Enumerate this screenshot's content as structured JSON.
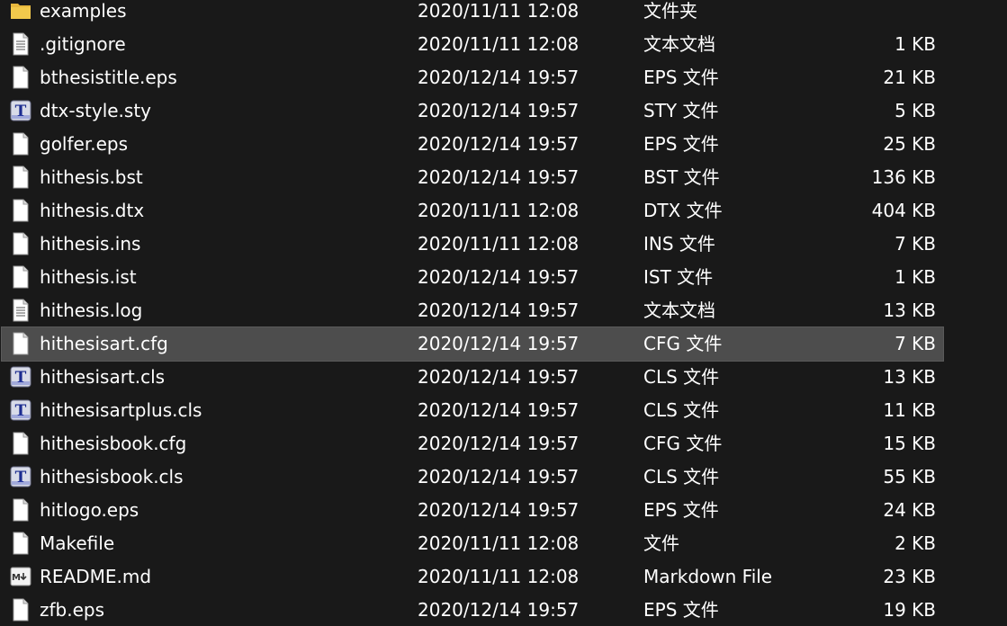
{
  "files": [
    {
      "name": "examples",
      "date": "2020/11/11 12:08",
      "type": "文件夹",
      "size": "",
      "icon": "folder-icon"
    },
    {
      "name": ".gitignore",
      "date": "2020/11/11 12:08",
      "type": "文本文档",
      "size": "1 KB",
      "icon": "text-file-icon"
    },
    {
      "name": "bthesistitle.eps",
      "date": "2020/12/14 19:57",
      "type": "EPS 文件",
      "size": "21 KB",
      "icon": "file-icon"
    },
    {
      "name": "dtx-style.sty",
      "date": "2020/12/14 19:57",
      "type": "STY 文件",
      "size": "5 KB",
      "icon": "tex-file-icon"
    },
    {
      "name": "golfer.eps",
      "date": "2020/12/14 19:57",
      "type": "EPS 文件",
      "size": "25 KB",
      "icon": "file-icon"
    },
    {
      "name": "hithesis.bst",
      "date": "2020/12/14 19:57",
      "type": "BST 文件",
      "size": "136 KB",
      "icon": "file-icon"
    },
    {
      "name": "hithesis.dtx",
      "date": "2020/11/11 12:08",
      "type": "DTX 文件",
      "size": "404 KB",
      "icon": "file-icon"
    },
    {
      "name": "hithesis.ins",
      "date": "2020/11/11 12:08",
      "type": "INS 文件",
      "size": "7 KB",
      "icon": "file-icon"
    },
    {
      "name": "hithesis.ist",
      "date": "2020/12/14 19:57",
      "type": "IST 文件",
      "size": "1 KB",
      "icon": "file-icon"
    },
    {
      "name": "hithesis.log",
      "date": "2020/12/14 19:57",
      "type": "文本文档",
      "size": "13 KB",
      "icon": "text-file-icon"
    },
    {
      "name": "hithesisart.cfg",
      "date": "2020/12/14 19:57",
      "type": "CFG 文件",
      "size": "7 KB",
      "icon": "file-icon",
      "selected": true
    },
    {
      "name": "hithesisart.cls",
      "date": "2020/12/14 19:57",
      "type": "CLS 文件",
      "size": "13 KB",
      "icon": "tex-file-icon"
    },
    {
      "name": "hithesisartplus.cls",
      "date": "2020/12/14 19:57",
      "type": "CLS 文件",
      "size": "11 KB",
      "icon": "tex-file-icon"
    },
    {
      "name": "hithesisbook.cfg",
      "date": "2020/12/14 19:57",
      "type": "CFG 文件",
      "size": "15 KB",
      "icon": "file-icon"
    },
    {
      "name": "hithesisbook.cls",
      "date": "2020/12/14 19:57",
      "type": "CLS 文件",
      "size": "55 KB",
      "icon": "tex-file-icon"
    },
    {
      "name": "hitlogo.eps",
      "date": "2020/12/14 19:57",
      "type": "EPS 文件",
      "size": "24 KB",
      "icon": "file-icon"
    },
    {
      "name": "Makefile",
      "date": "2020/11/11 12:08",
      "type": "文件",
      "size": "2 KB",
      "icon": "file-icon"
    },
    {
      "name": "README.md",
      "date": "2020/11/11 12:08",
      "type": "Markdown File",
      "size": "23 KB",
      "icon": "markdown-file-icon"
    },
    {
      "name": "zfb.eps",
      "date": "2020/12/14 19:57",
      "type": "EPS 文件",
      "size": "19 KB",
      "icon": "file-icon"
    }
  ],
  "colors": {
    "background": "#191919",
    "selected_row": "#4d4d4d",
    "text": "#ffffff",
    "folder": "#e8b83e"
  }
}
